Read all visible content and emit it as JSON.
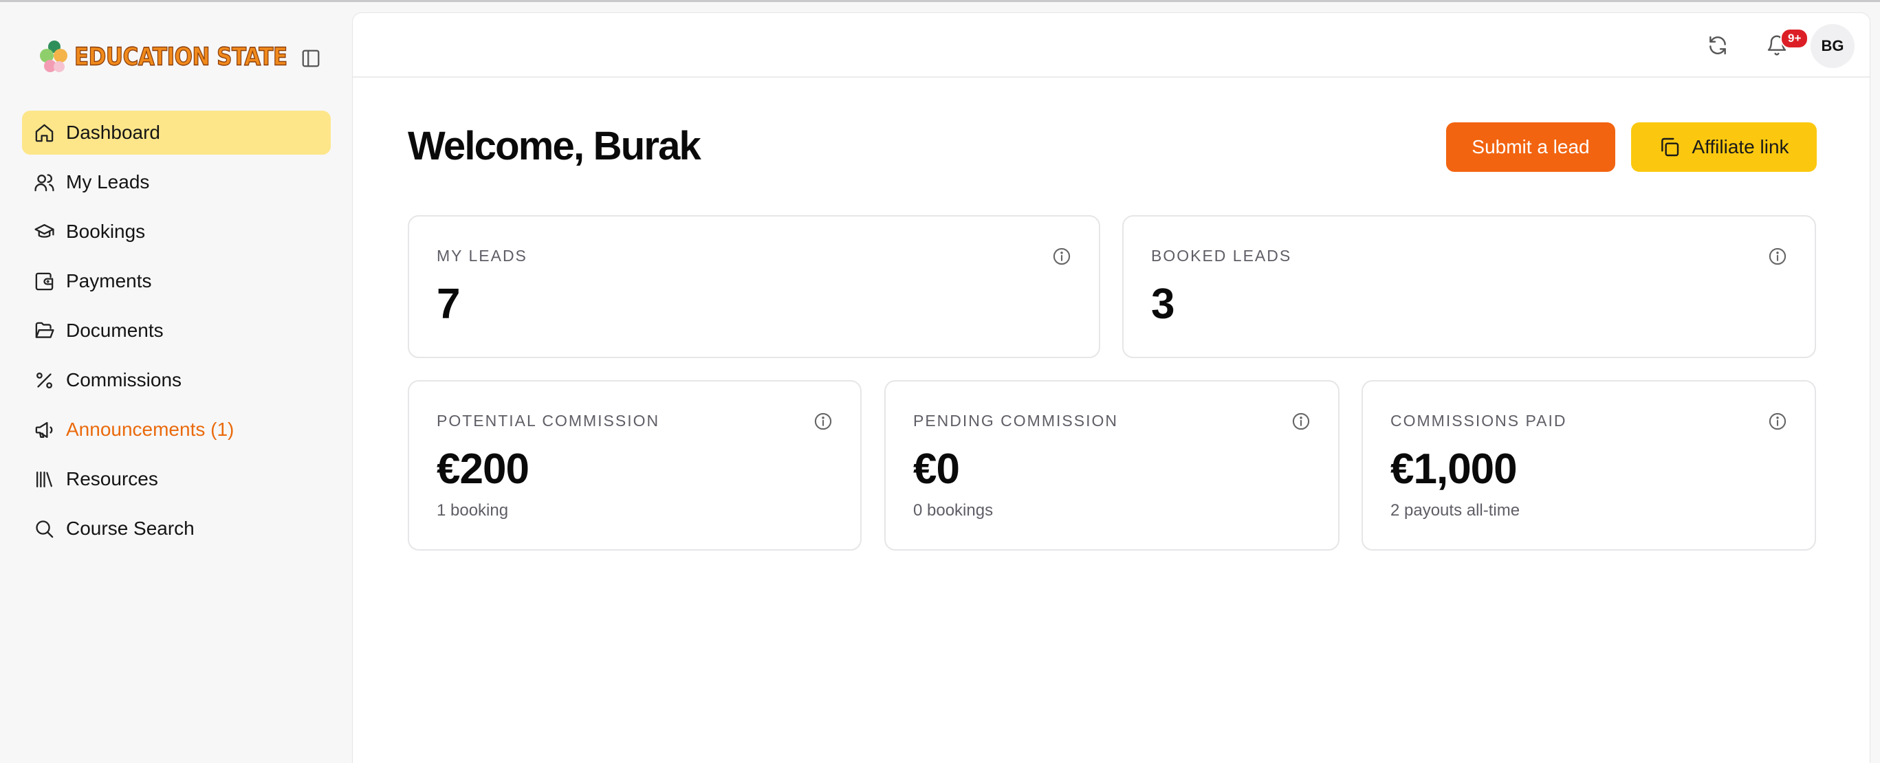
{
  "brand": {
    "name": "EDUCATION STATE",
    "logo_icon": "clover-logo-icon"
  },
  "sidebar": {
    "items": [
      {
        "label": "Dashboard",
        "icon": "home-icon",
        "active": true
      },
      {
        "label": "My Leads",
        "icon": "users-icon"
      },
      {
        "label": "Bookings",
        "icon": "graduation-cap-icon"
      },
      {
        "label": "Payments",
        "icon": "wallet-icon"
      },
      {
        "label": "Documents",
        "icon": "folder-open-icon"
      },
      {
        "label": "Commissions",
        "icon": "percent-icon"
      },
      {
        "label": "Announcements (1)",
        "icon": "megaphone-icon",
        "highlight_color": "#ea6a0c"
      },
      {
        "label": "Resources",
        "icon": "library-icon"
      },
      {
        "label": "Course Search",
        "icon": "search-icon"
      }
    ]
  },
  "header": {
    "notifications_badge": "9+",
    "avatar_initials": "BG"
  },
  "main": {
    "welcome": "Welcome, Burak",
    "submit_lead_label": "Submit a lead",
    "affiliate_link_label": "Affiliate link"
  },
  "stats": {
    "my_leads": {
      "label": "MY LEADS",
      "value": "7"
    },
    "booked_leads": {
      "label": "BOOKED LEADS",
      "value": "3"
    },
    "potential_commission": {
      "label": "POTENTIAL COMMISSION",
      "value": "€200",
      "sub": "1 booking"
    },
    "pending_commission": {
      "label": "PENDING COMMISSION",
      "value": "€0",
      "sub": "0 bookings"
    },
    "commissions_paid": {
      "label": "COMMISSIONS PAID",
      "value": "€1,000",
      "sub": "2 payouts all-time"
    }
  },
  "colors": {
    "accent_orange": "#f26410",
    "accent_yellow": "#fbc80f",
    "active_nav_bg": "#fde68a",
    "badge_red": "#dc1f26"
  }
}
